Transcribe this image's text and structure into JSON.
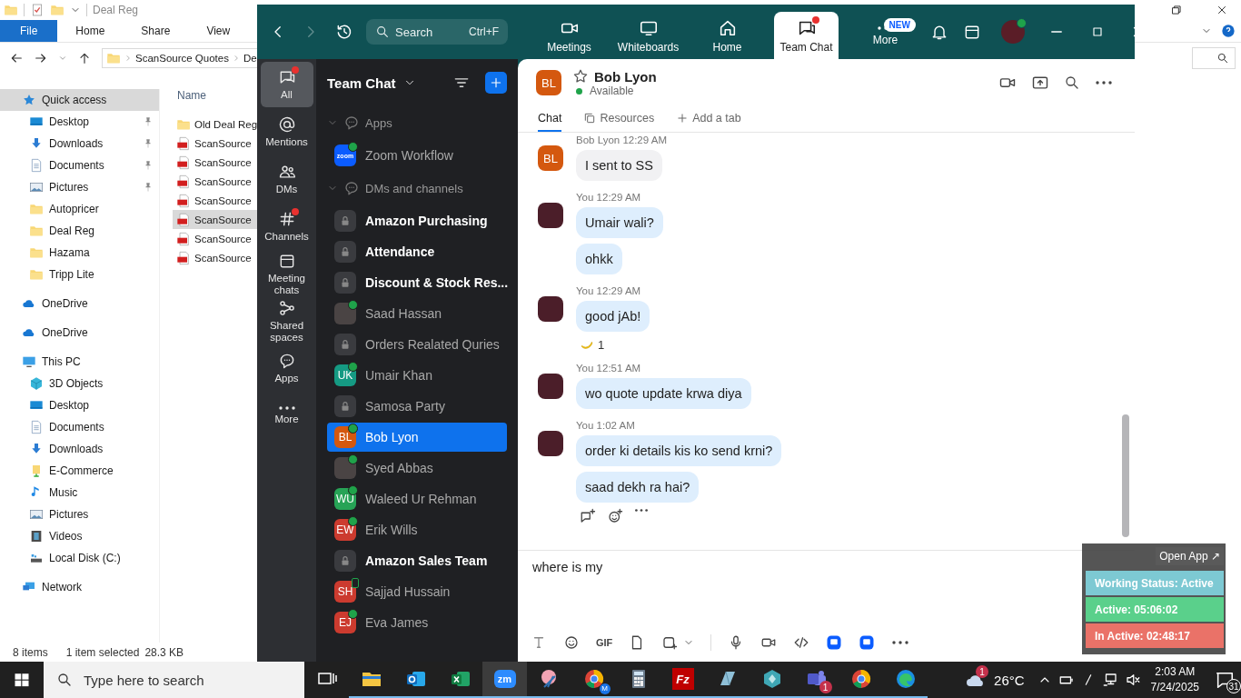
{
  "explorer": {
    "title": "Deal Reg",
    "ribbon_tabs": [
      {
        "label": "File",
        "selected": true
      },
      {
        "label": "Home",
        "selected": false
      },
      {
        "label": "Share",
        "selected": false
      },
      {
        "label": "View",
        "selected": false
      }
    ],
    "breadcrumb": [
      "ScanSource Quotes",
      "De"
    ],
    "nav_pane": [
      {
        "label": "Quick access",
        "kind": "star-filled",
        "selected": true,
        "children": [
          {
            "label": "Desktop",
            "kind": "monitor",
            "pinned": true,
            "selected": false
          },
          {
            "label": "Downloads",
            "kind": "download-arrow",
            "pinned": true,
            "selected": false
          },
          {
            "label": "Documents",
            "kind": "document",
            "pinned": true,
            "selected": false
          },
          {
            "label": "Pictures",
            "kind": "picture",
            "pinned": true,
            "selected": false
          },
          {
            "label": "Autopricer",
            "kind": "folder",
            "pinned": false,
            "selected": false
          },
          {
            "label": "Deal Reg",
            "kind": "folder",
            "pinned": false,
            "selected": false
          },
          {
            "label": "Hazama",
            "kind": "folder",
            "pinned": false,
            "selected": false
          },
          {
            "label": "Tripp Lite",
            "kind": "folder",
            "pinned": false,
            "selected": false
          }
        ]
      },
      {
        "label": "OneDrive",
        "kind": "cloud",
        "selected": false
      },
      {
        "label": "OneDrive",
        "kind": "cloud",
        "selected": false
      },
      {
        "label": "This PC",
        "kind": "computer",
        "selected": false,
        "children": [
          {
            "label": "3D Objects",
            "kind": "cube",
            "selected": false
          },
          {
            "label": "Desktop",
            "kind": "monitor",
            "selected": false
          },
          {
            "label": "Documents",
            "kind": "document",
            "selected": false
          },
          {
            "label": "Downloads",
            "kind": "download-arrow",
            "selected": false
          },
          {
            "label": "E-Commerce",
            "kind": "library-folder",
            "selected": false
          },
          {
            "label": "Music",
            "kind": "music-note",
            "selected": false
          },
          {
            "label": "Pictures",
            "kind": "picture",
            "selected": false
          },
          {
            "label": "Videos",
            "kind": "film",
            "selected": false
          },
          {
            "label": "Local Disk (C:)",
            "kind": "disk-drive",
            "selected": false
          }
        ]
      },
      {
        "label": "Network",
        "kind": "network",
        "selected": false
      }
    ],
    "column_header": "Name",
    "files": [
      {
        "name": "Old Deal Reg",
        "kind": "folder",
        "selected": false
      },
      {
        "name": "ScanSource",
        "kind": "pdf-file",
        "selected": false
      },
      {
        "name": "ScanSource",
        "kind": "pdf-file",
        "selected": false
      },
      {
        "name": "ScanSource",
        "kind": "pdf-file",
        "selected": false
      },
      {
        "name": "ScanSource",
        "kind": "pdf-file",
        "selected": false
      },
      {
        "name": "ScanSource",
        "kind": "pdf-file",
        "selected": true
      },
      {
        "name": "ScanSource",
        "kind": "pdf-file",
        "selected": false
      },
      {
        "name": "ScanSource",
        "kind": "pdf-file",
        "selected": false
      }
    ],
    "status_bar": {
      "items": "8 items",
      "selection": "1 item selected",
      "size": "28.3 KB"
    }
  },
  "zoom": {
    "search": {
      "placeholder": "Search",
      "shortcut": "Ctrl+F"
    },
    "nav": [
      {
        "label": "Meetings",
        "kind": "video",
        "selected": false,
        "unread": false
      },
      {
        "label": "Whiteboards",
        "kind": "whiteboard",
        "selected": false,
        "unread": false
      },
      {
        "label": "Home",
        "kind": "house",
        "selected": false,
        "unread": false
      },
      {
        "label": "Team Chat",
        "kind": "chat",
        "selected": true,
        "unread": true
      },
      {
        "label": "More",
        "kind": "dots",
        "selected": false,
        "unread": false,
        "badge": "NEW"
      }
    ],
    "user_online": true,
    "rail": [
      {
        "label": "All",
        "kind": "chat",
        "selected": true,
        "unread": true
      },
      {
        "label": "Mentions",
        "kind": "at",
        "selected": false,
        "unread": false
      },
      {
        "label": "DMs",
        "kind": "people",
        "selected": false,
        "unread": false
      },
      {
        "label": "Channels",
        "kind": "hash",
        "selected": false,
        "unread": true
      },
      {
        "label": "Meeting chats",
        "kind": "calendar",
        "selected": false,
        "unread": false
      },
      {
        "label": "Shared spaces",
        "kind": "nodes",
        "selected": false,
        "unread": false
      },
      {
        "label": "Apps",
        "kind": "bubble",
        "selected": false,
        "unread": false
      },
      {
        "label": "More",
        "kind": "dots",
        "selected": false,
        "unread": false
      }
    ],
    "list_title": "Team Chat",
    "sections": [
      {
        "title": "Apps",
        "expanded": true,
        "items": [
          {
            "name": "Zoom Workflow",
            "kind": "app",
            "logo": "zoom",
            "online": true,
            "mobile": false,
            "bold": false,
            "selected": false
          }
        ]
      },
      {
        "title": "DMs and channels",
        "expanded": true,
        "items": [
          {
            "name": "Amazon Purchasing",
            "kind": "channel",
            "bold": true,
            "selected": false
          },
          {
            "name": "Attendance",
            "kind": "channel",
            "bold": true,
            "selected": false
          },
          {
            "name": "Discount & Stock Res...",
            "kind": "channel",
            "bold": true,
            "selected": false
          },
          {
            "name": "Saad Hassan",
            "kind": "photo",
            "online": true,
            "mobile": false,
            "bold": false,
            "selected": false
          },
          {
            "name": "Orders Realated Quries",
            "kind": "channel",
            "bold": false,
            "selected": false
          },
          {
            "name": "Umair Khan",
            "kind": "initials",
            "initials": "UK",
            "color": "#159a83",
            "online": true,
            "mobile": false,
            "bold": false,
            "selected": false
          },
          {
            "name": "Samosa Party",
            "kind": "channel",
            "bold": false,
            "selected": false
          },
          {
            "name": "Bob Lyon",
            "kind": "initials",
            "initials": "BL",
            "color": "#d4580f",
            "online": true,
            "mobile": false,
            "bold": false,
            "selected": true
          },
          {
            "name": "Syed Abbas",
            "kind": "photo",
            "online": true,
            "mobile": false,
            "bold": false,
            "selected": false
          },
          {
            "name": "Waleed Ur Rehman",
            "kind": "initials",
            "initials": "WU",
            "color": "#27a356",
            "online": true,
            "mobile": false,
            "bold": false,
            "selected": false
          },
          {
            "name": "Erik Wills",
            "kind": "initials",
            "initials": "EW",
            "color": "#cc3b2f",
            "online": true,
            "mobile": false,
            "bold": false,
            "selected": false
          },
          {
            "name": "Amazon Sales Team",
            "kind": "channel",
            "bold": true,
            "selected": false
          },
          {
            "name": "Sajjad Hussain",
            "kind": "initials",
            "initials": "SH",
            "color": "#cc3b2f",
            "online": false,
            "mobile": true,
            "bold": false,
            "selected": false
          },
          {
            "name": "Eva James",
            "kind": "initials",
            "initials": "EJ",
            "color": "#cc3b2f",
            "online": true,
            "mobile": false,
            "bold": false,
            "selected": false
          }
        ]
      }
    ],
    "conversation": {
      "name": "Bob Lyon",
      "initials": "BL",
      "color": "#d4580f",
      "status": "Available",
      "online": true,
      "tabs": [
        {
          "label": "Chat",
          "kind": "plain",
          "selected": true
        },
        {
          "label": "Resources",
          "kind": "copy",
          "selected": false
        },
        {
          "label": "Add a tab",
          "kind": "plus",
          "selected": false
        }
      ],
      "messages": [
        {
          "sender": "Bob Lyon",
          "time": "12:29 AM",
          "mine": false,
          "initials": "BL",
          "color": "#d4580f",
          "bubbles": [
            "I sent to SS"
          ]
        },
        {
          "sender": "You",
          "time": "12:29 AM",
          "mine": true,
          "bubbles": [
            "Umair wali?",
            "ohkk"
          ]
        },
        {
          "sender": "You",
          "time": "12:29 AM",
          "mine": true,
          "bubbles": [
            "good jAb!"
          ],
          "reaction_count": "1"
        },
        {
          "sender": "You",
          "time": "12:51 AM",
          "mine": true,
          "bubbles": [
            "wo quote update krwa diya"
          ]
        },
        {
          "sender": "You",
          "time": "1:02 AM",
          "mine": true,
          "bubbles": [
            "order ki details kis ko send krni?",
            "saad dekh ra hai?"
          ],
          "actions": true
        }
      ]
    },
    "composer": {
      "value": "where is my",
      "gif": "GIF"
    }
  },
  "tracker": {
    "open_button": "Open App ↗",
    "rows": [
      {
        "text": "Working Status: Active",
        "color": "#7dc9d3"
      },
      {
        "text": "Active: 05:06:02",
        "color": "#5ad08b"
      },
      {
        "text": "In Active: 02:48:17",
        "color": "#ea7268"
      }
    ]
  },
  "taskbar": {
    "search_placeholder": "Type here to search",
    "apps": [
      {
        "kind": "task-view",
        "running": false,
        "selected": false
      },
      {
        "kind": "folder-app",
        "running": true,
        "selected": false
      },
      {
        "kind": "mail-app",
        "running": true,
        "selected": false
      },
      {
        "kind": "spreadsheet-app",
        "running": true,
        "selected": false
      },
      {
        "kind": "video-chat-app",
        "label": "zm",
        "running": true,
        "selected": true
      },
      {
        "kind": "snipping-app",
        "running": true,
        "selected": false
      },
      {
        "kind": "browser-app",
        "label": "M",
        "running": true,
        "selected": false
      },
      {
        "kind": "calculator-app",
        "running": true,
        "selected": false
      },
      {
        "kind": "ftp-app",
        "label": "Fz",
        "running": true,
        "selected": false
      },
      {
        "kind": "notepad-app",
        "running": true,
        "selected": false
      },
      {
        "kind": "gem-app",
        "running": true,
        "selected": false
      },
      {
        "kind": "team-app",
        "badge": "1",
        "running": true,
        "selected": false
      },
      {
        "kind": "browser-app",
        "running": true,
        "selected": false
      },
      {
        "kind": "edge-app",
        "running": true,
        "selected": false
      }
    ],
    "weather": {
      "badge": "1",
      "temp": "26°C"
    },
    "time": "2:03 AM",
    "date": "7/24/2025",
    "notifications": "31"
  }
}
